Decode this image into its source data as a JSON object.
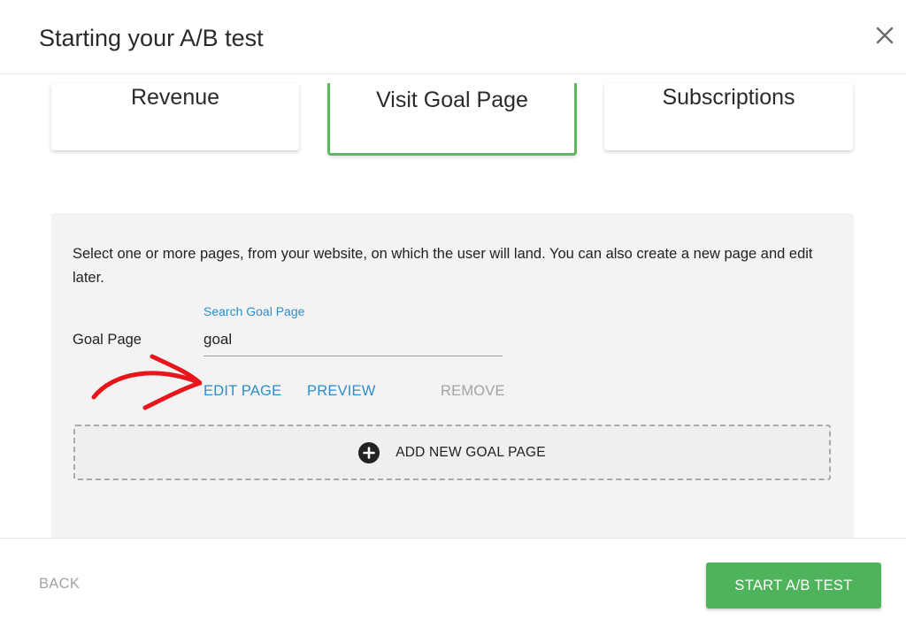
{
  "header": {
    "title": "Starting your A/B test",
    "close_icon": "close-icon"
  },
  "goal_types": [
    {
      "label": "Revenue",
      "selected": false
    },
    {
      "label": "Visit Goal Page",
      "selected": true
    },
    {
      "label": "Subscriptions",
      "selected": false
    }
  ],
  "panel": {
    "description": "Select one or more pages, from your website, on which the user will land. You can also create a new page and edit later.",
    "goal_label": "Goal Page",
    "search_label": "Search Goal Page",
    "search_value": "goal",
    "edit_label": "EDIT PAGE",
    "preview_label": "PREVIEW",
    "remove_label": "REMOVE",
    "add_label": "ADD NEW GOAL PAGE",
    "add_icon": "plus-circle-icon"
  },
  "footer": {
    "back_label": "BACK",
    "start_label": "START A/B TEST"
  },
  "colors": {
    "accent_green": "#4fb35c",
    "selected_border": "#5cb85c",
    "link_blue": "#2a8fcc",
    "muted_gray": "#a3a3a3",
    "annotation_red": "#e8151b"
  }
}
